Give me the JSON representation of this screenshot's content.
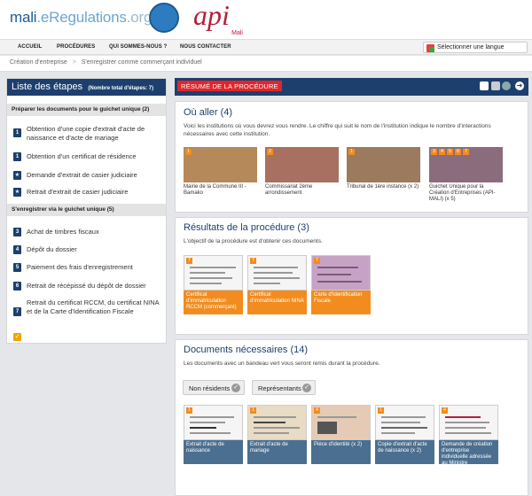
{
  "header": {
    "logo": {
      "part1": "mali",
      "part2": ".eRegulations",
      "part3": ".org"
    },
    "partner_logo": {
      "main": "api",
      "sub": "Mali"
    },
    "nav": [
      "ACCUEIL",
      "PROCÉDURES",
      "QUI SOMMES-NOUS ?",
      "NOUS CONTACTER"
    ],
    "language": "Sélectionner une langue"
  },
  "breadcrumb": {
    "items": [
      "Création d'entreprise",
      "S'enregistrer comme commerçant individuel"
    ],
    "separator": ">"
  },
  "sidebar": {
    "title": "Liste des étapes",
    "count": "(Nombre total d'étapes: 7)",
    "sections": [
      {
        "label": "Préparer les documents pour le guichet unique  (2)",
        "steps": [
          {
            "badge": "1",
            "text": "Obtention d'une copie d'extrait d'acte de naissance et d'acte de mariage"
          },
          {
            "badge": "1",
            "text": "Obtention d'un certificat de résidence"
          },
          {
            "badge": "★",
            "text": "Demande d'extrait de casier judiciaire"
          },
          {
            "badge": "★",
            "text": "Retrait d'extrait de casier judiciaire"
          }
        ]
      },
      {
        "label": "S'enregistrer via le guichet unique  (5)",
        "steps": [
          {
            "badge": "3",
            "text": "Achat de timbres fiscaux"
          },
          {
            "badge": "4",
            "text": "Dépôt du dossier"
          },
          {
            "badge": "5",
            "text": "Paiement des frais d'enregistrement"
          },
          {
            "badge": "6",
            "text": "Retrait de récépissé du dépôt de dossier"
          },
          {
            "badge": "7",
            "text": "Retrait du certificat RCCM, du certificat NINA et de la Carte d'Identification Fiscale"
          }
        ]
      }
    ]
  },
  "main": {
    "header_label": "RÉSUMÉ DE LA PROCÉDURE",
    "ou_aller": {
      "title": "Où aller (4)",
      "desc": "Voici les institutions où vous devrez vous rendre. Le chiffre qui suit le nom de l'institution indique le nombre d'interactions nécessaires avec cette institution.",
      "cards": [
        {
          "nums": [
            "1"
          ],
          "caption": "Mairie de la Commune III - Bamako",
          "color": "#b5895a"
        },
        {
          "nums": [
            "2"
          ],
          "caption": "Commissariat 2ème arrondissement",
          "color": "#a87060"
        },
        {
          "nums": [
            "1"
          ],
          "caption": "Tribunal de 1ère instance (x 2)",
          "color": "#9c7a5e"
        },
        {
          "nums": [
            "3",
            "4",
            "5",
            "6",
            "7"
          ],
          "caption": "Guichet Unique pour la Création d'Entreprises (API-MALI) (x 5)",
          "color": "#8a6c7d"
        }
      ]
    },
    "resultats": {
      "title": "Résultats de la procédure (3)",
      "desc": "L'objectif de la procédure est d'obtenir ces documents.",
      "docs": [
        {
          "num": "7",
          "caption": "Certificat d'immatriculation RCCM (commerçant)"
        },
        {
          "num": "7",
          "caption": "Certificat d'immatriculation NINA"
        },
        {
          "num": "7",
          "caption": "Carte d'Identification Fiscale"
        }
      ]
    },
    "documents": {
      "title": "Documents nécessaires (14)",
      "desc": "Les documents avec un bandeau vert vous seront remis durant la procédure.",
      "filters": [
        "Non résidents",
        "Représentants"
      ],
      "docs": [
        {
          "num": "1",
          "caption": "Extrait d'acte de naissance"
        },
        {
          "num": "1",
          "caption": "Extrait d'acte de mariage"
        },
        {
          "num": "4",
          "caption": "Pièce d'identité (x 2)"
        },
        {
          "num": "1",
          "caption": "Copie d'extrait d'acte de naissance (x 2)"
        },
        {
          "num": "4",
          "caption": "Demande de création d'entreprise individuelle adressée au Ministre"
        }
      ]
    }
  }
}
